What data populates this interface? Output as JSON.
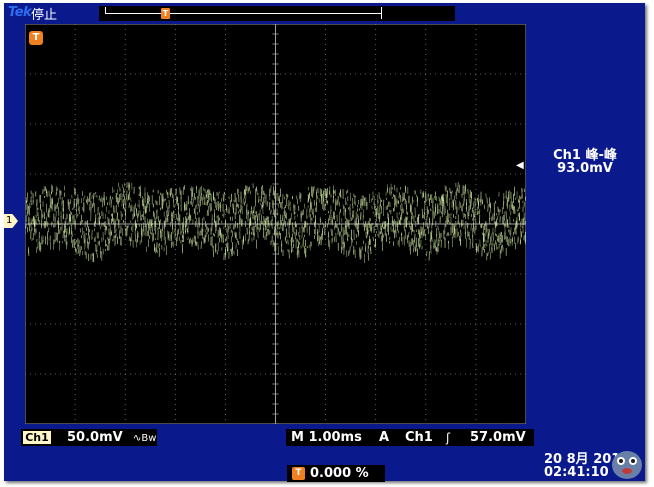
{
  "header": {
    "brand": "Tek",
    "status": "停止"
  },
  "markers": {
    "trigger_position_label": "T",
    "channel_ground_label": "1"
  },
  "measurement": {
    "label": "Ch1 峰-峰",
    "value": "93.0mV"
  },
  "bottom": {
    "channel_badge": "Ch1",
    "channel_scale": "50.0mV",
    "bandwidth_icon": "bandwidth-limit-icon",
    "timebase": "M 1.00ms",
    "trigger_mode": "A",
    "trigger_source": "Ch1",
    "trigger_slope_icon": "rising-edge-icon",
    "trigger_level": "57.0mV",
    "trigger_position_icon": "T",
    "trigger_position": "0.000 %",
    "date": "20 8月  2014",
    "time": "02:41:10"
  },
  "chart_data": {
    "type": "line",
    "series": [
      {
        "values": [
          0.6,
          -0.4,
          0.9,
          -0.7,
          0.5,
          -0.3,
          0.8,
          -0.6,
          0.7,
          -0.5,
          0.9,
          -0.4,
          0.6,
          -0.7,
          0.8,
          -0.3
        ]
      }
    ],
    "grid": true
  },
  "colors": {
    "screen_bg": "#0a1a8c",
    "graticule_bg": "#000000",
    "trace": "#d7f0a8",
    "accent": "#f08020"
  }
}
